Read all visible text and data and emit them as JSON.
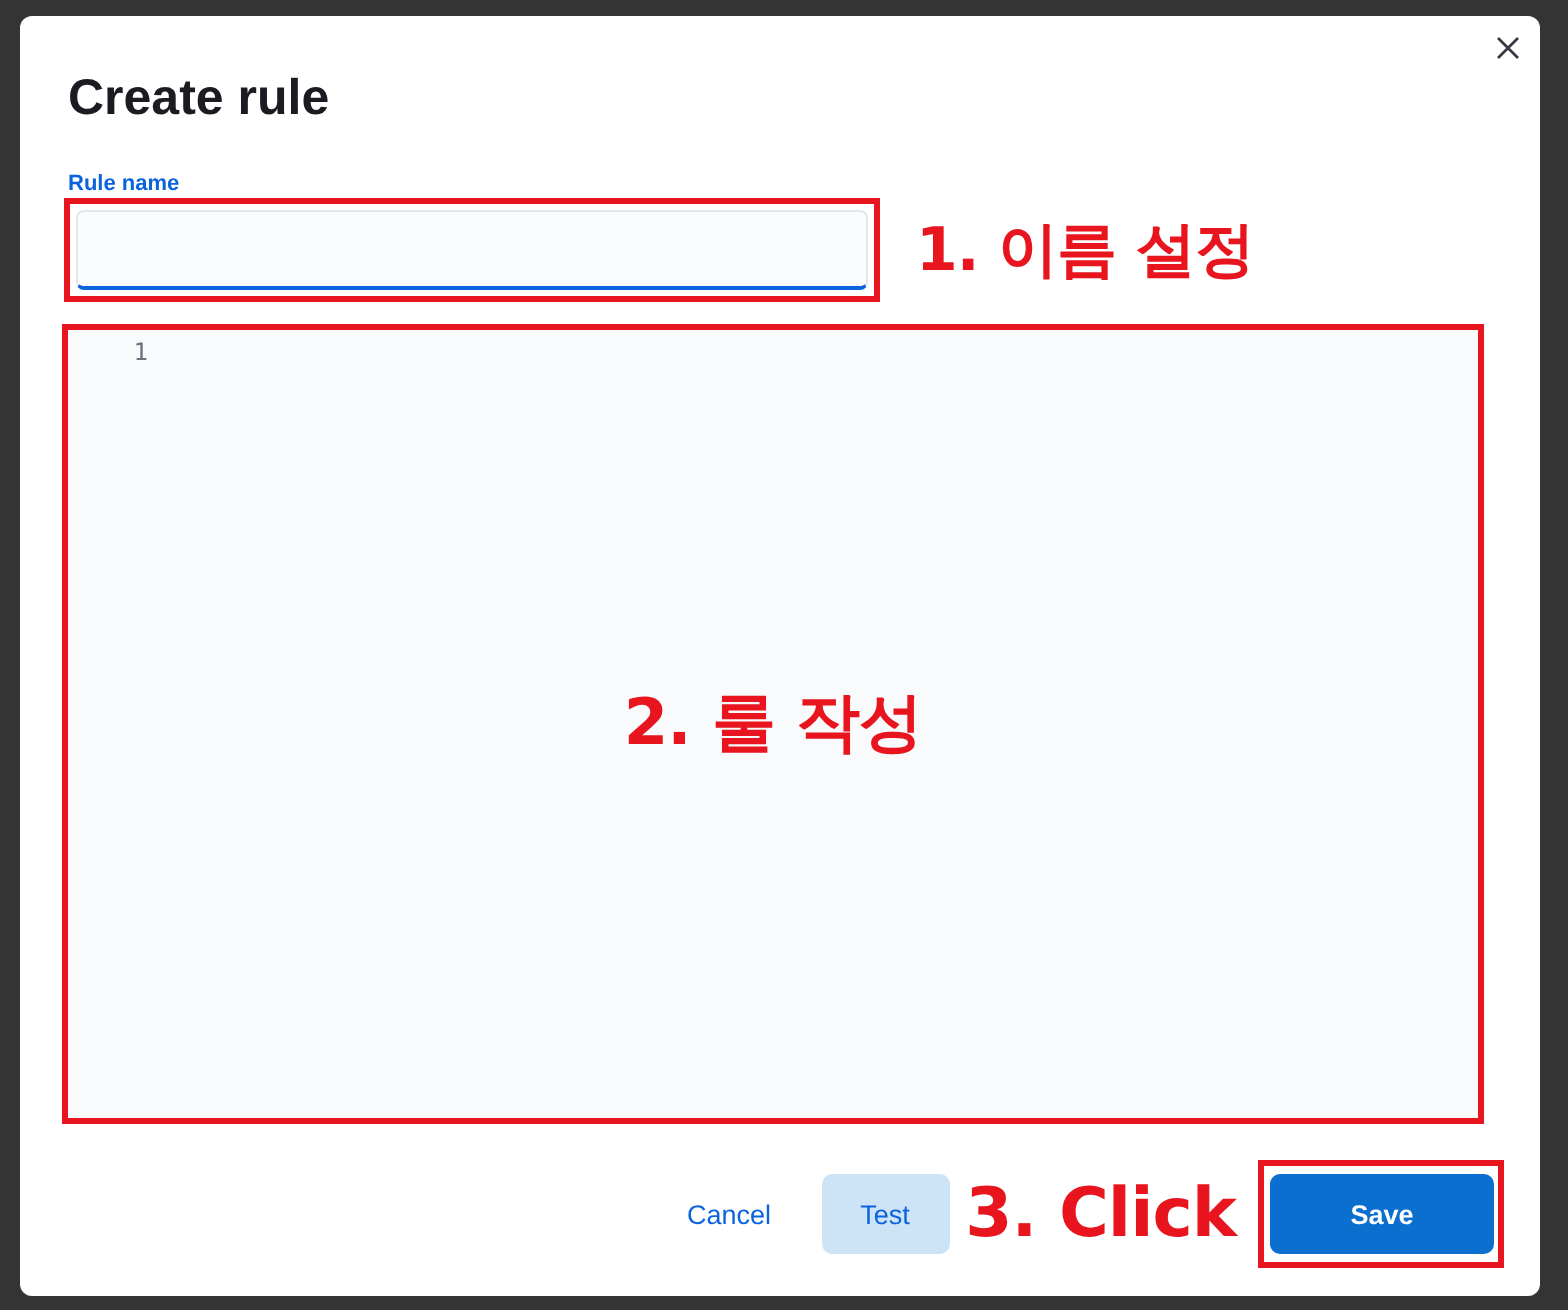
{
  "modal": {
    "title": "Create rule"
  },
  "rule_name": {
    "label": "Rule name"
  },
  "editor": {
    "line_numbers": [
      "1"
    ]
  },
  "footer": {
    "cancel": "Cancel",
    "test": "Test",
    "save": "Save"
  },
  "annotations": [
    {
      "text": "1. 이름 설정"
    },
    {
      "text": "2. 룰 작성"
    },
    {
      "text": "3. Click"
    }
  ]
}
